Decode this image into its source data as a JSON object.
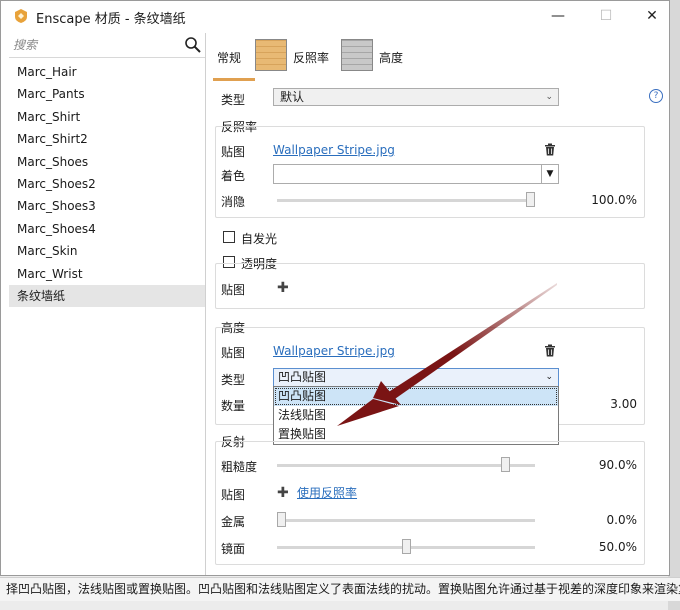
{
  "window": {
    "title": "Enscape 材质 - 条纹墙纸"
  },
  "sidebar": {
    "search_placeholder": "搜索",
    "items": [
      "Marc_Hair",
      "Marc_Pants",
      "Marc_Shirt",
      "Marc_Shirt2",
      "Marc_Shoes",
      "Marc_Shoes2",
      "Marc_Shoes3",
      "Marc_Shoes4",
      "Marc_Skin",
      "Marc_Wrist",
      "条纹墙纸"
    ],
    "selected_index": 10
  },
  "tabs": [
    {
      "label": "常规",
      "active": true
    },
    {
      "label": "反照率",
      "active": false
    },
    {
      "label": "高度",
      "active": false
    }
  ],
  "general": {
    "type_label": "类型",
    "type_value": "默认",
    "help": "?"
  },
  "albedo": {
    "heading": "反照率",
    "map_label": "贴图",
    "map_file": "Wallpaper Stripe.jpg",
    "tint_label": "着色",
    "fade_label": "消隐",
    "fade_value": "100.0%",
    "fade_level": 1.0
  },
  "emissive": {
    "label": "自发光",
    "checked": false
  },
  "transparency": {
    "label": "透明度",
    "checked": false,
    "map_label": "贴图"
  },
  "height": {
    "heading": "高度",
    "map_label": "贴图",
    "map_file": "Wallpaper Stripe.jpg",
    "type_label": "类型",
    "type_value": "凹凸贴图",
    "amount_label": "数量",
    "amount_value": "3.00",
    "options": [
      "凹凸贴图",
      "法线贴图",
      "置换贴图"
    ],
    "selected_option": 0
  },
  "reflection": {
    "heading": "反射",
    "roughness_label": "粗糙度",
    "roughness_value": "90.0%",
    "roughness_level": 0.9,
    "map_label": "贴图",
    "map_link": "使用反照率",
    "metal_label": "金属",
    "metal_value": "0.0%",
    "metal_level": 0.0,
    "specular_label": "镜面",
    "specular_value": "50.0%",
    "specular_level": 0.5
  },
  "status": {
    "text": "择凹凸贴图，法线贴图或置换贴图。凹凸贴图和法线贴图定义了表面法线的扰动。置换贴图允许通过基于视差的深度印象来渲染复杂"
  },
  "colors": {
    "accent_tab": "#e0a050",
    "link": "#2a6ebd",
    "annotation_arrow": "#7a1414"
  },
  "icons": {
    "app": "enscape-logo-icon",
    "search": "search-icon",
    "trash": "trash-icon",
    "add": "plus-icon",
    "help": "help-icon"
  }
}
